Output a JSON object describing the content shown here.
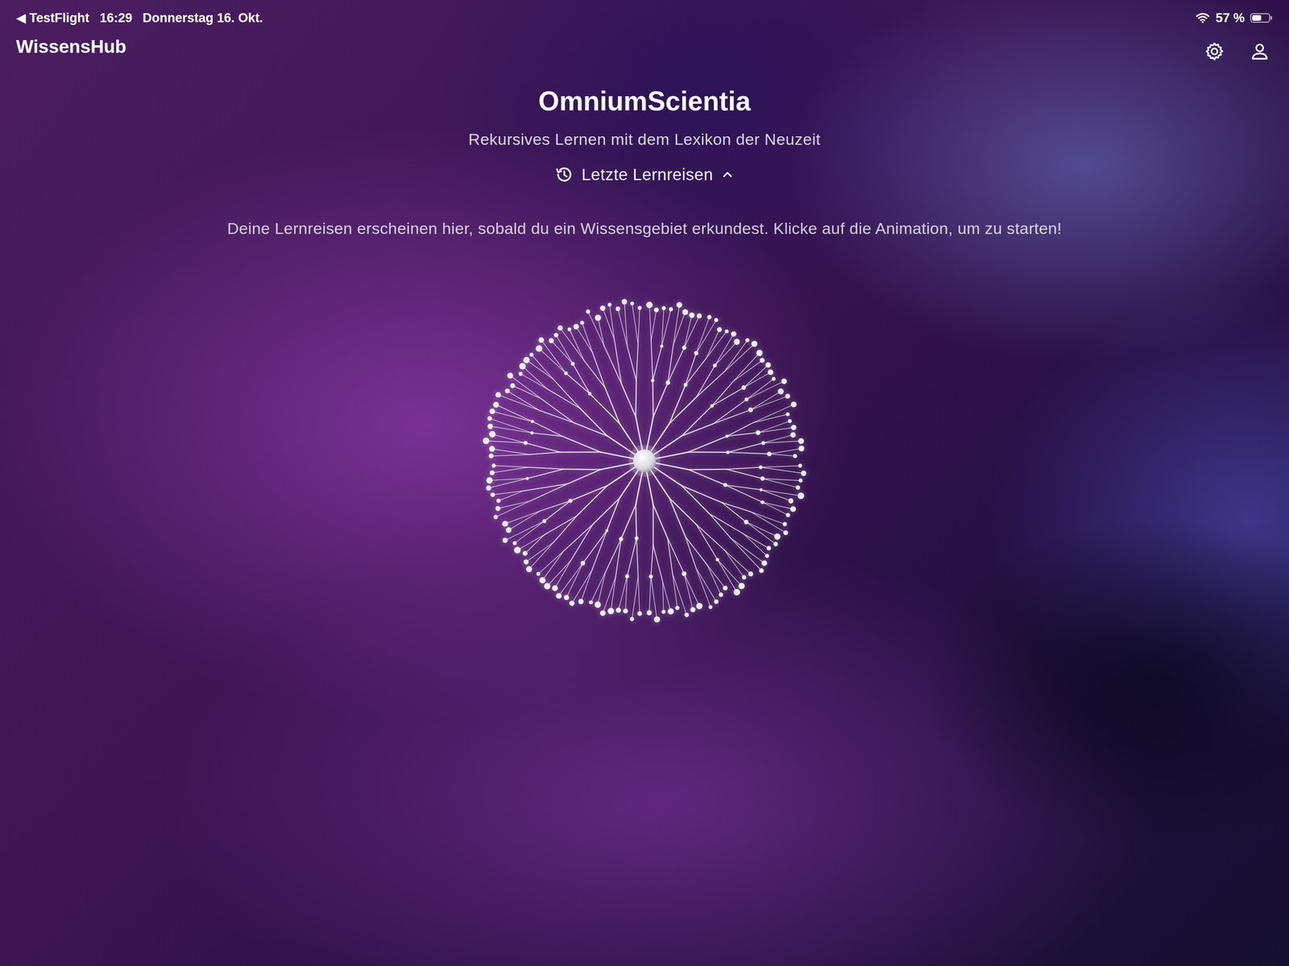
{
  "status_bar": {
    "back": "◀",
    "app": "TestFlight",
    "time": "16:29",
    "date": "Donnerstag 16. Okt.",
    "battery": "57 %",
    "battery_level": 0.57
  },
  "header": {
    "title": "WissensHub"
  },
  "hero": {
    "title": "OmniumScientia",
    "subtitle": "Rekursives Lernen mit dem Lexikon der Neuzeit"
  },
  "recent": {
    "label": "Letzte Lernreisen",
    "expanded": true,
    "empty_text": "Deine Lernreisen erscheinen hier, sobald du ein Wissensgebiet erkundest. Klicke auf die Animation, um zu starten!"
  }
}
